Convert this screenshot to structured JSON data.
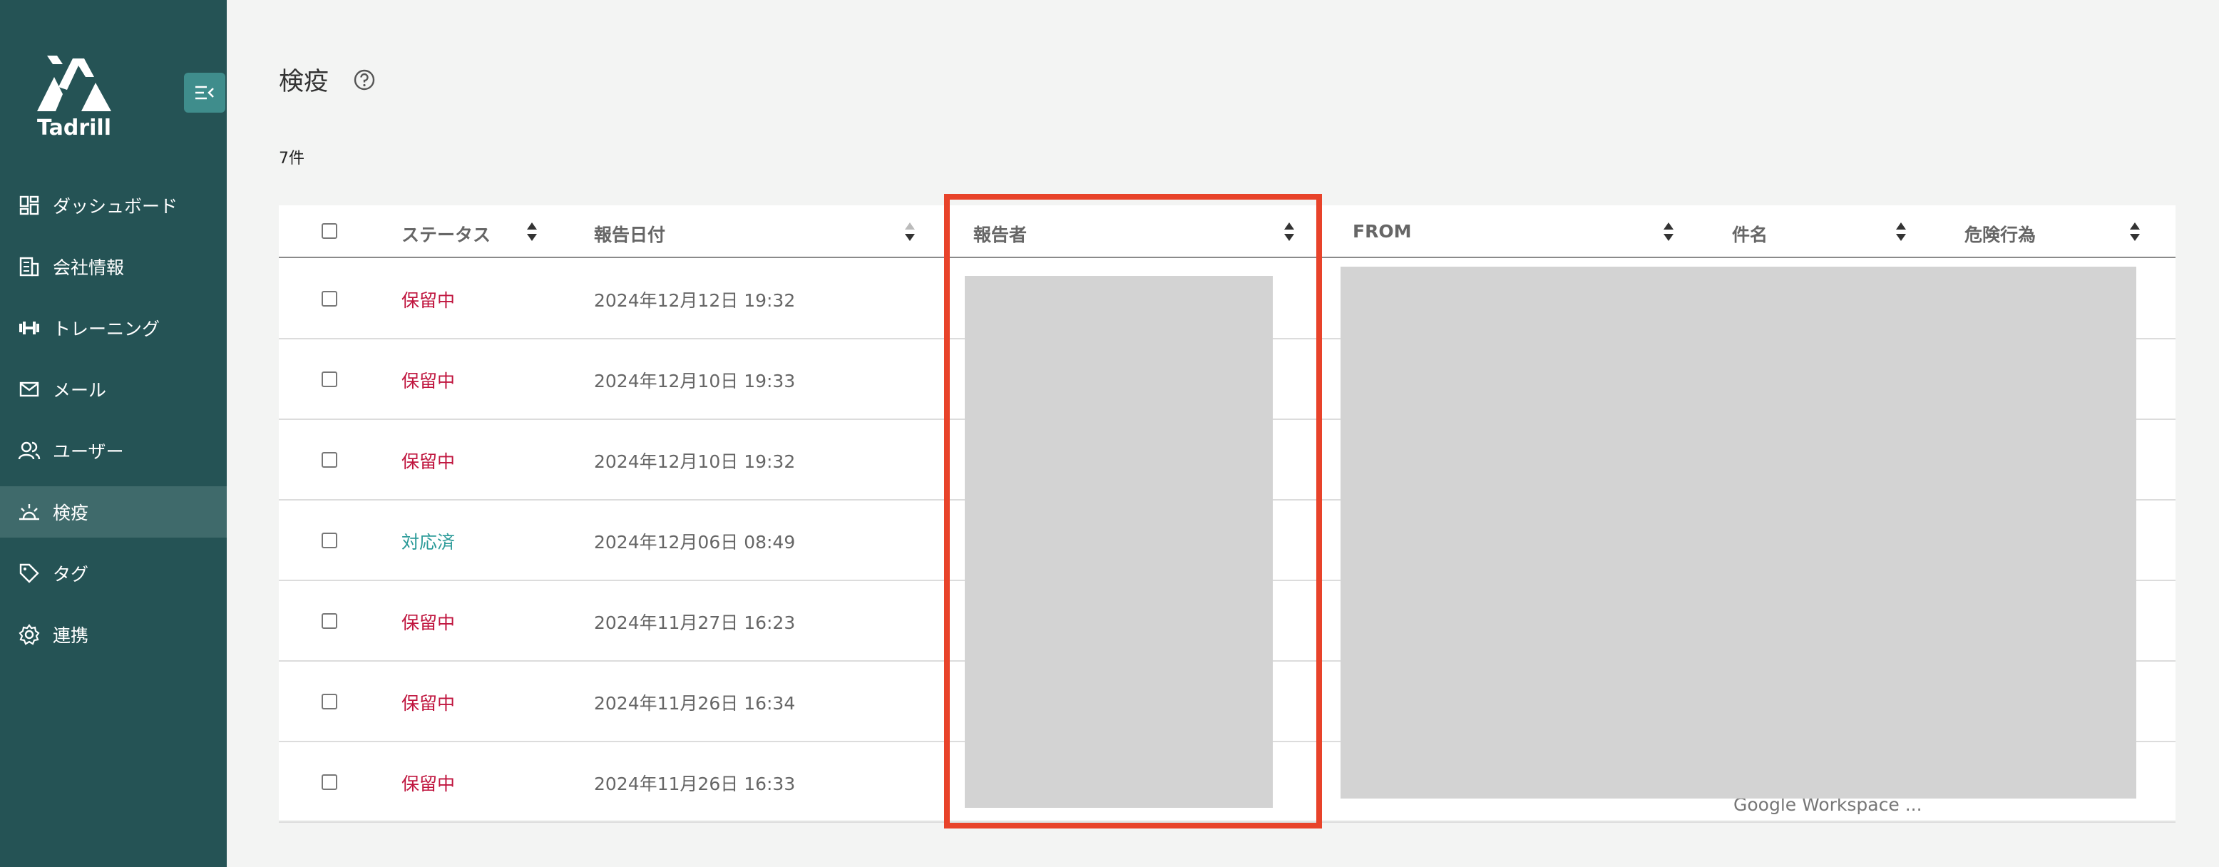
{
  "brand": {
    "name": "Tadrill"
  },
  "sidebar": {
    "items": [
      {
        "label": "ダッシュボード",
        "icon": "dashboard-icon"
      },
      {
        "label": "会社情報",
        "icon": "building-icon"
      },
      {
        "label": "トレーニング",
        "icon": "dumbbell-icon"
      },
      {
        "label": "メール",
        "icon": "mail-icon"
      },
      {
        "label": "ユーザー",
        "icon": "users-icon"
      },
      {
        "label": "検疫",
        "icon": "quarantine-icon",
        "active": true
      },
      {
        "label": "タグ",
        "icon": "tag-icon"
      },
      {
        "label": "連携",
        "icon": "gear-icon"
      }
    ]
  },
  "page": {
    "title": "検疫",
    "count": "7件"
  },
  "table": {
    "columns": [
      "ステータス",
      "報告日付",
      "報告者",
      "FROM",
      "件名",
      "危険行為"
    ],
    "rows": [
      {
        "status": "保留中",
        "date": "2024年12月12日 19:32"
      },
      {
        "status": "保留中",
        "date": "2024年12月10日 19:33"
      },
      {
        "status": "保留中",
        "date": "2024年12月10日 19:32"
      },
      {
        "status": "対応済",
        "date": "2024年12月06日 08:49"
      },
      {
        "status": "保留中",
        "date": "2024年11月27日 16:23"
      },
      {
        "status": "保留中",
        "date": "2024年11月26日 16:34"
      },
      {
        "status": "保留中",
        "date": "2024年11月26日 16:33",
        "subject_partial": "Google Workspace ..."
      }
    ]
  },
  "colors": {
    "sidebar": "#255355",
    "sidebar_active": "#3f6a6b",
    "accent": "#3f8d8c",
    "status_pending": "#c0163f",
    "status_done": "#2a9a98",
    "highlight": "#e8432a",
    "redaction": "#d3d3d3"
  }
}
